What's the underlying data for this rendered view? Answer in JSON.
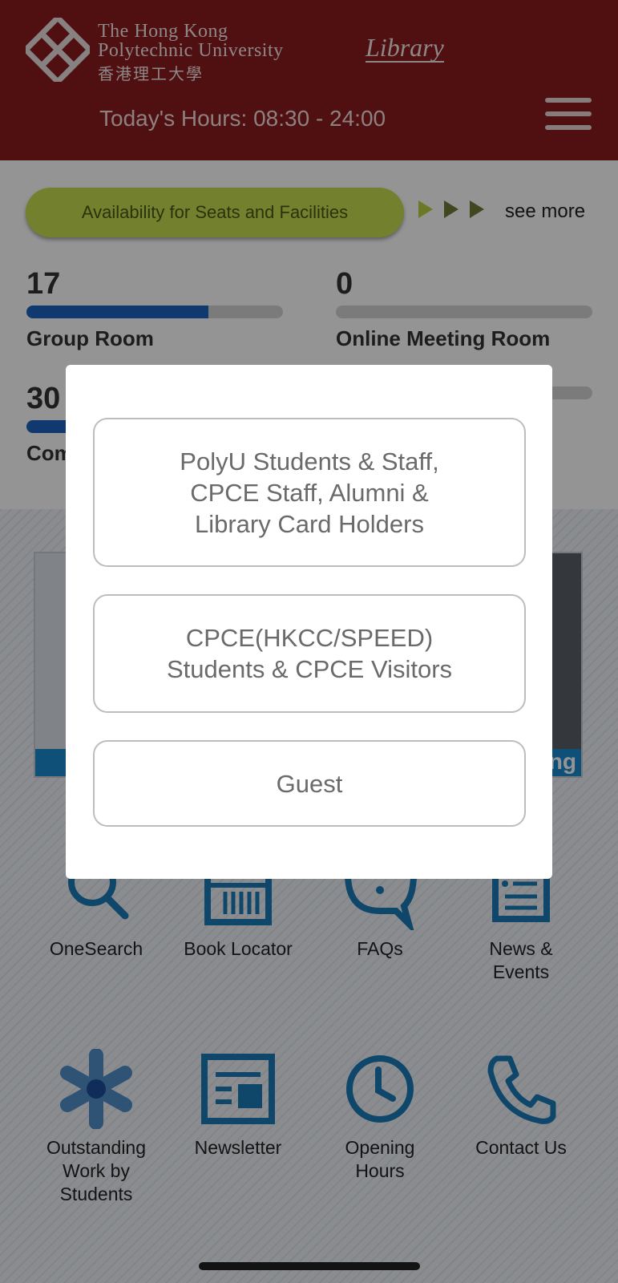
{
  "header": {
    "university_line1": "The Hong Kong",
    "university_line2": "Polytechnic University",
    "university_chinese": "香港理工大學",
    "library_word": "Library",
    "hours_text": "Today's Hours: 08:30 - 24:00",
    "menu_icon": "hamburger-menu-icon",
    "background_color": "#8b1a1c"
  },
  "availability": {
    "button_label": "Availability for Seats and Facilities",
    "see_more_label": "see more",
    "accent_color": "#c6dc4e",
    "stats": [
      {
        "value": "17",
        "label": "Group Room",
        "fill_fraction": 0.71
      },
      {
        "value": "0",
        "label": "Online Meeting Room",
        "fill_fraction": 0
      },
      {
        "value": "30",
        "label": "Com",
        "fill_fraction": 0.5
      },
      {
        "value": "",
        "label": "",
        "fill_fraction": 0
      }
    ],
    "bar_color": "#1d62c2"
  },
  "banner": {
    "right_strip_text": "ng"
  },
  "icon_grid": [
    {
      "label": "OneSearch",
      "icon": "search-icon"
    },
    {
      "label": "Book Locator",
      "icon": "bookshelf-icon"
    },
    {
      "label": "FAQs",
      "icon": "speech-bubble-icon"
    },
    {
      "label": "News &\nEvents",
      "icon": "clipboard-list-icon"
    },
    {
      "label": "Outstanding\nWork by\nStudents",
      "icon": "asterisk-star-icon"
    },
    {
      "label": "Newsletter",
      "icon": "newspaper-icon"
    },
    {
      "label": "Opening\nHours",
      "icon": "clock-icon"
    },
    {
      "label": "Contact Us",
      "icon": "phone-icon"
    }
  ],
  "modal": {
    "options": [
      {
        "label": "PolyU Students & Staff,\nCPCE Staff, Alumni &\nLibrary Card Holders"
      },
      {
        "label": "CPCE(HKCC/SPEED)\nStudents & CPCE Visitors"
      },
      {
        "label": "Guest"
      }
    ]
  },
  "colors": {
    "icon_blue": "#1b7ab8",
    "modal_text": "#6a6a6a"
  }
}
